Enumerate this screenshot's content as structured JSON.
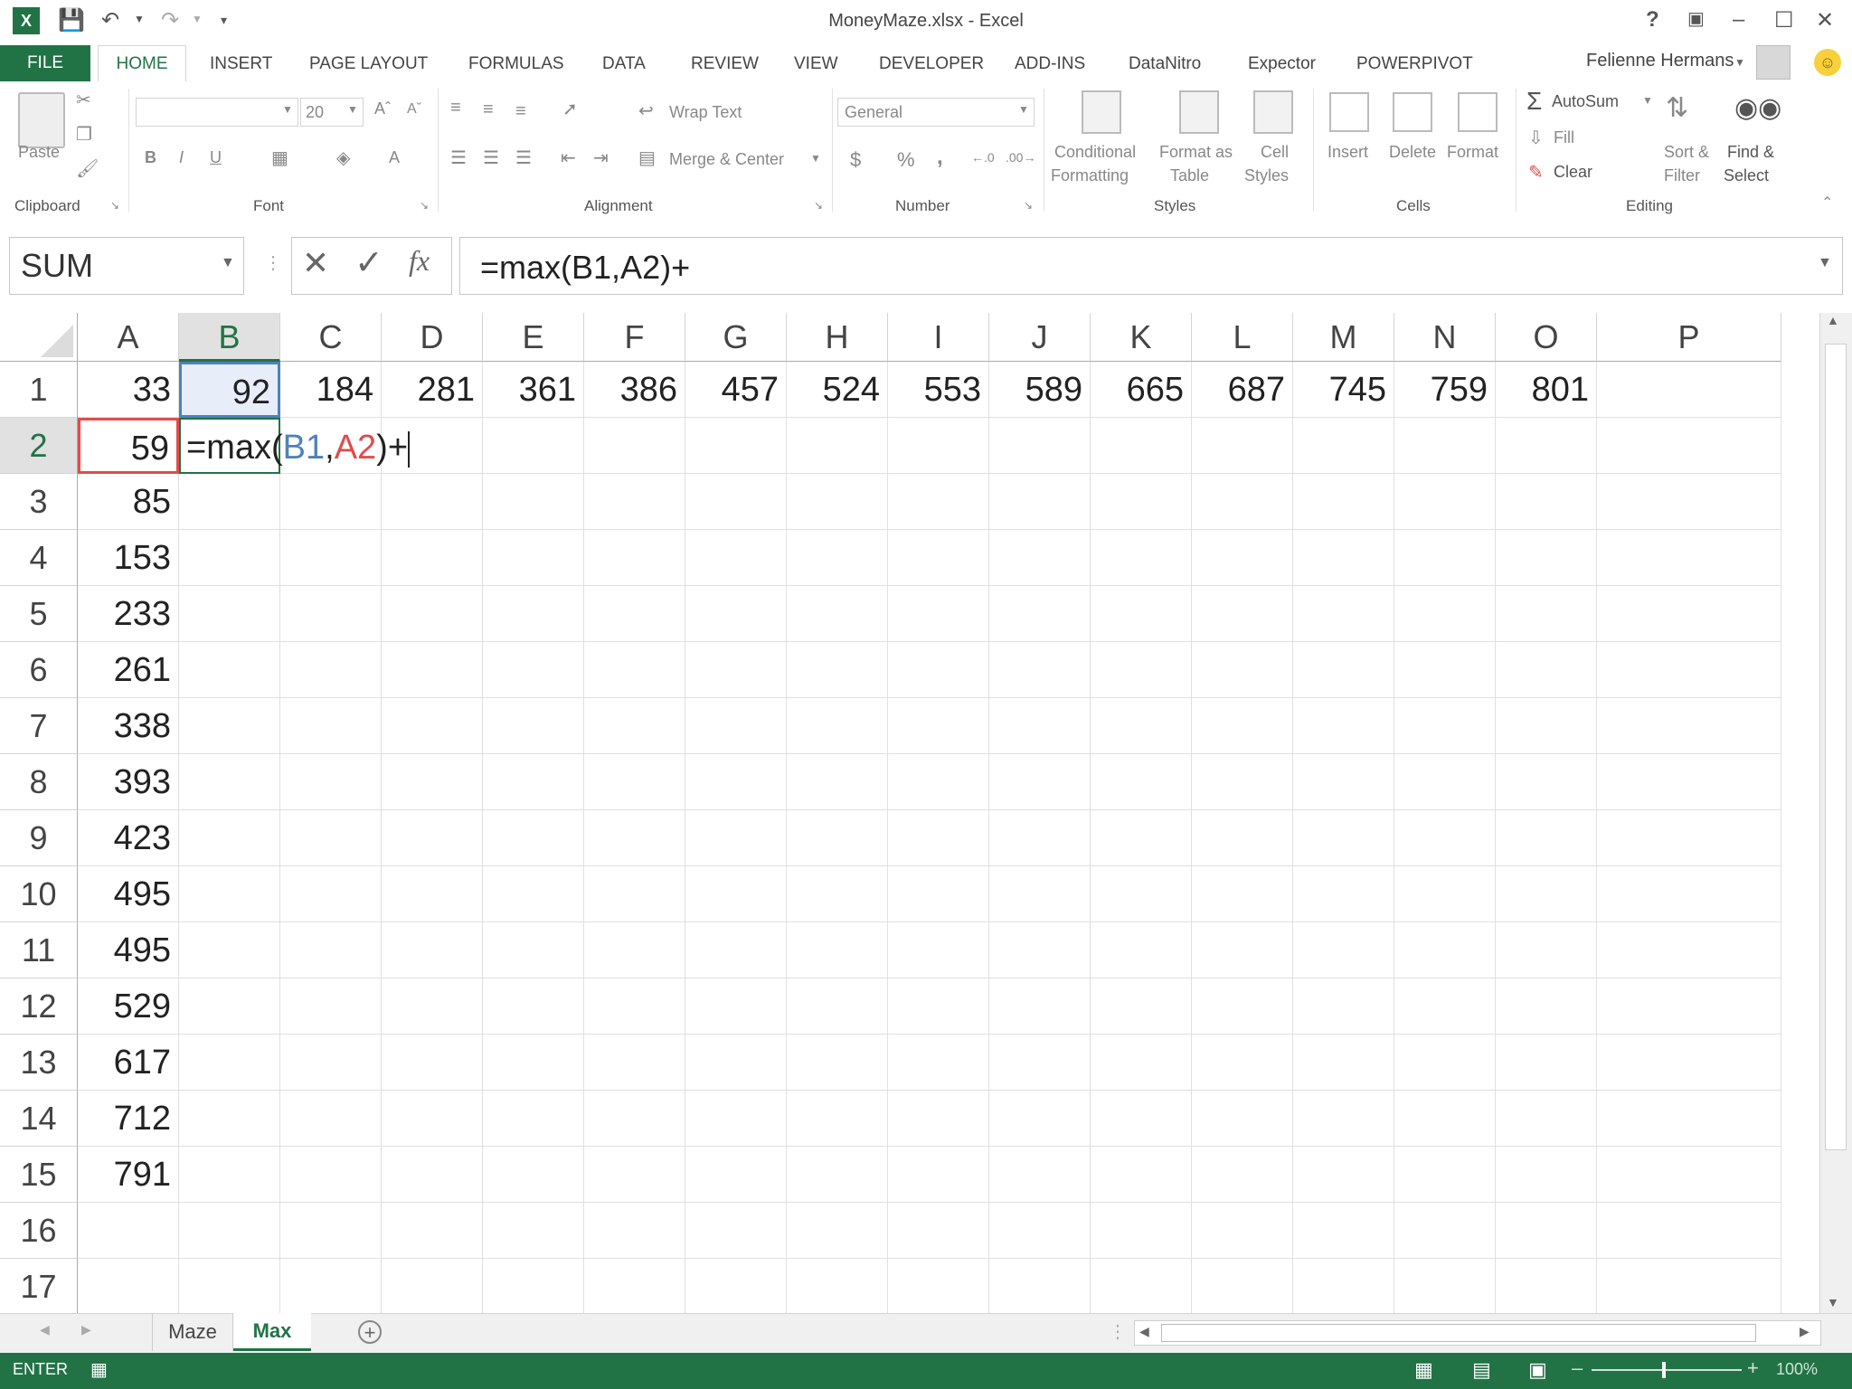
{
  "title_bar": {
    "title": "MoneyMaze.xlsx - Excel",
    "help": "?"
  },
  "tabs": {
    "file": "FILE",
    "items": [
      "HOME",
      "INSERT",
      "PAGE LAYOUT",
      "FORMULAS",
      "DATA",
      "REVIEW",
      "VIEW",
      "DEVELOPER",
      "ADD-INS",
      "DataNitro",
      "Expector",
      "POWERPIVOT"
    ],
    "user": "Felienne Hermans"
  },
  "ribbon": {
    "clipboard": {
      "paste": "Paste",
      "label": "Clipboard"
    },
    "font": {
      "size": "20",
      "label": "Font",
      "bold": "B",
      "italic": "I",
      "underline": "U"
    },
    "alignment": {
      "wrap": "Wrap Text",
      "merge": "Merge & Center",
      "label": "Alignment"
    },
    "number": {
      "format": "General",
      "currency": "$",
      "percent": "%",
      "comma": ",",
      "label": "Number"
    },
    "styles": {
      "conditional_1": "Conditional",
      "conditional_2": "Formatting",
      "format_table_1": "Format as",
      "format_table_2": "Table",
      "cell_styles_1": "Cell",
      "cell_styles_2": "Styles",
      "label": "Styles"
    },
    "cells": {
      "insert": "Insert",
      "delete": "Delete",
      "format": "Format",
      "label": "Cells"
    },
    "editing": {
      "autosum": "AutoSum",
      "fill": "Fill",
      "clear": "Clear",
      "sort_1": "Sort &",
      "sort_2": "Filter",
      "find_1": "Find &",
      "find_2": "Select",
      "label": "Editing"
    }
  },
  "formula_bar": {
    "name_box": "SUM",
    "formula": "=max(B1,A2)+"
  },
  "grid": {
    "columns": [
      "A",
      "B",
      "C",
      "D",
      "E",
      "F",
      "G",
      "H",
      "I",
      "J",
      "K",
      "L",
      "M",
      "N",
      "O",
      "P"
    ],
    "row_headers": [
      "1",
      "2",
      "3",
      "4",
      "5",
      "6",
      "7",
      "8",
      "9",
      "10",
      "11",
      "12",
      "13",
      "14",
      "15",
      "16",
      "17"
    ],
    "row1": [
      "33",
      "92",
      "184",
      "281",
      "361",
      "386",
      "457",
      "524",
      "553",
      "589",
      "665",
      "687",
      "745",
      "759",
      "801"
    ],
    "colA": [
      "59",
      "85",
      "153",
      "233",
      "261",
      "338",
      "393",
      "423",
      "495",
      "495",
      "529",
      "617",
      "712",
      "791"
    ],
    "edit_cell": {
      "prefix": "=max(",
      "ref1": "B1",
      "comma": ",",
      "ref2": "A2",
      "suffix": ")+"
    }
  },
  "sheets": {
    "tabs": [
      "Maze",
      "Max"
    ],
    "active": "Max"
  },
  "status": {
    "mode": "ENTER",
    "zoom": "100%"
  },
  "colors": {
    "excel_green": "#217346",
    "ref_blue": "#4f81bd",
    "ref_red": "#e24b4b"
  }
}
